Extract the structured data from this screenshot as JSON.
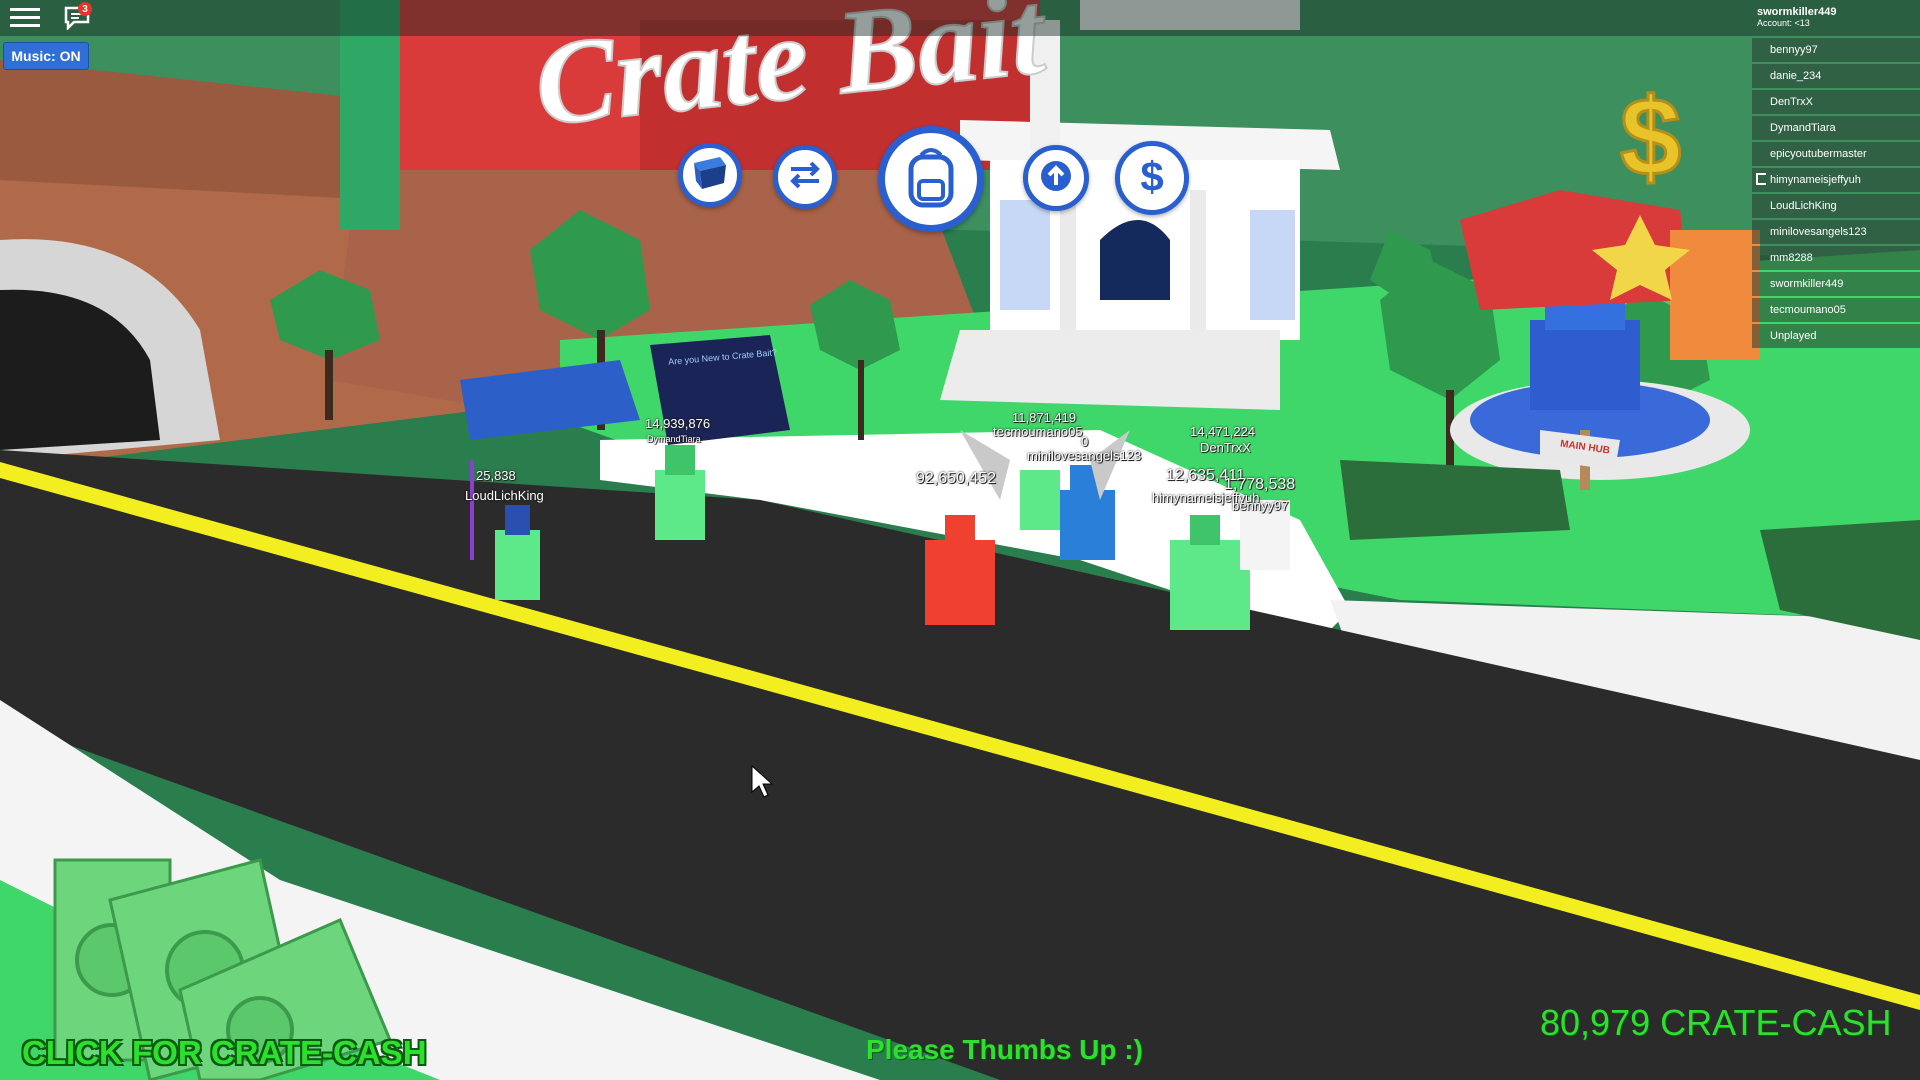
{
  "hud": {
    "chat_badge": "3",
    "music_button": "Music: ON",
    "account_name": "swormkiller449",
    "account_age": "Account: <13"
  },
  "players": [
    "bennyy97",
    "danie_234",
    "DenTrxX",
    "DymandTiara",
    "epicyoutubermaster",
    "himynameisjeffyuh",
    "LoudLichKing",
    "minilovesangels123",
    "mm8288",
    "swormkiller449",
    "tecmoumano05",
    "Unplayed"
  ],
  "toolbar": {
    "crate_icon": "crate-icon",
    "trade_icon": "swap-arrows-icon",
    "backpack_icon": "backpack-icon",
    "upgrade_icon": "up-arrow-icon",
    "shop_icon": "dollar-icon"
  },
  "world": {
    "sign_title": "Are you New to Crate Bait?",
    "building_logo": "CRATE BAIT",
    "hub_sign": "MAIN HUB",
    "nametags": {
      "dymand_cash": "14,939,876",
      "dymand_name": "DymandTiara",
      "loud_cash": "25,838",
      "loud_name": "LoudLichKing",
      "tecmo_cash": "11,871,419",
      "tecmo_name": "tecmoumano05",
      "mini_cash": "0",
      "mini_name": "minilovesangels123",
      "big_cash": "92,650,452",
      "den_cash": "14,471,224",
      "den_name": "DenTrxX",
      "himy_cash": "12,635,411",
      "himy_name": "himynameisjeffyuh",
      "benny_cash": "1,778,538",
      "benny_name": "bennyy97"
    }
  },
  "bottom": {
    "click_label": "CLICK FOR CRATE-CASH",
    "thumbs_label": "Please Thumbs Up :)",
    "cash_total": "80,979 CRATE-CASH"
  },
  "colors": {
    "accent_blue": "#2a5fcf",
    "cash_green": "#2ee02e",
    "road": "#2b2b2b",
    "road_line": "#f2ee1f",
    "grass": "#2fcf5a"
  }
}
